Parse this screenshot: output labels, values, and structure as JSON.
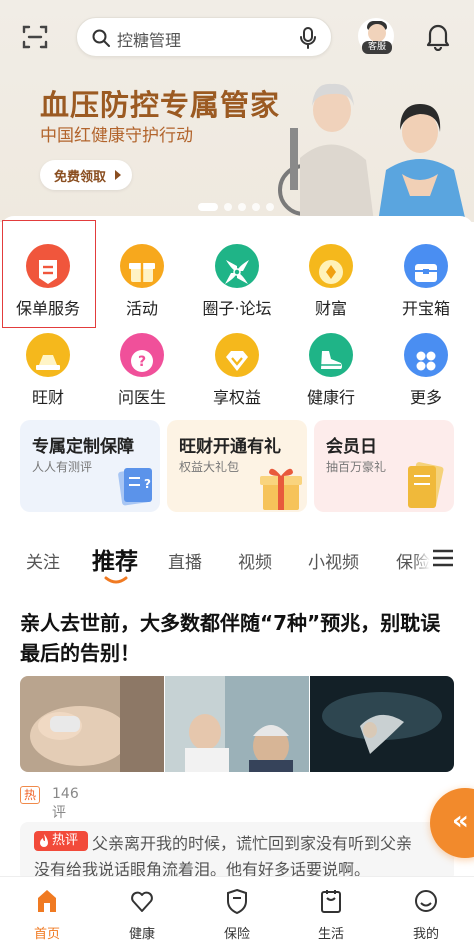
{
  "search": {
    "placeholder": "控糖管理"
  },
  "header": {
    "avatar_label": "客服"
  },
  "banner": {
    "title": "血压防控专属管家",
    "subtitle": "中国红健康守护行动",
    "button_label": "免费领取"
  },
  "grid": [
    {
      "label": "保单服务",
      "icon": "policy-icon",
      "color": "#f0563c"
    },
    {
      "label": "活动",
      "icon": "gift-icon",
      "color": "#f7a81d"
    },
    {
      "label": "圈子·论坛",
      "icon": "pinwheel-icon",
      "color": "#1fb487"
    },
    {
      "label": "财富",
      "icon": "coin-icon",
      "color": "#f5b81c"
    },
    {
      "label": "开宝箱",
      "icon": "treasure-box-icon",
      "color": "#4a8ef2"
    },
    {
      "label": "旺财",
      "icon": "gold-bar-icon",
      "color": "#f5b81c"
    },
    {
      "label": "问医生",
      "icon": "question-icon",
      "color": "#f0509a"
    },
    {
      "label": "享权益",
      "icon": "diamond-icon",
      "color": "#f5b81c"
    },
    {
      "label": "健康行",
      "icon": "shoe-icon",
      "color": "#1fb487"
    },
    {
      "label": "更多",
      "icon": "more-apps-icon",
      "color": "#4a8ef2"
    }
  ],
  "cards": [
    {
      "title": "专属定制保障",
      "subtitle": "人人有测评"
    },
    {
      "title": "旺财开通有礼",
      "subtitle": "权益大礼包"
    },
    {
      "title": "会员日",
      "subtitle": "抽百万豪礼"
    }
  ],
  "tabs": [
    "关注",
    "推荐",
    "直播",
    "视频",
    "小视频",
    "保险"
  ],
  "article": {
    "title": "亲人去世前，大多数都伴随“7种”预兆，别耽误最后的告别！",
    "hot_tag": "热",
    "comments": "146评"
  },
  "hot_comment": {
    "badge": "热评",
    "line1": "父亲离开我的时候，谎忙回到家没有听到父亲",
    "line2": "没有给我说话眼角流着泪。他有好多话要说啊。"
  },
  "float_button": {
    "label": "«"
  },
  "bottom_nav": [
    {
      "label": "首页",
      "icon": "home-icon",
      "active": true
    },
    {
      "label": "健康",
      "icon": "heart-icon",
      "active": false
    },
    {
      "label": "保险",
      "icon": "shield-icon",
      "active": false
    },
    {
      "label": "生活",
      "icon": "calendar-bag-icon",
      "active": false
    },
    {
      "label": "我的",
      "icon": "smiley-icon",
      "active": false
    }
  ],
  "colors": {
    "accent": "#f07a22",
    "banner_title": "#9b5a22",
    "highlight_border": "#e23c3c"
  }
}
